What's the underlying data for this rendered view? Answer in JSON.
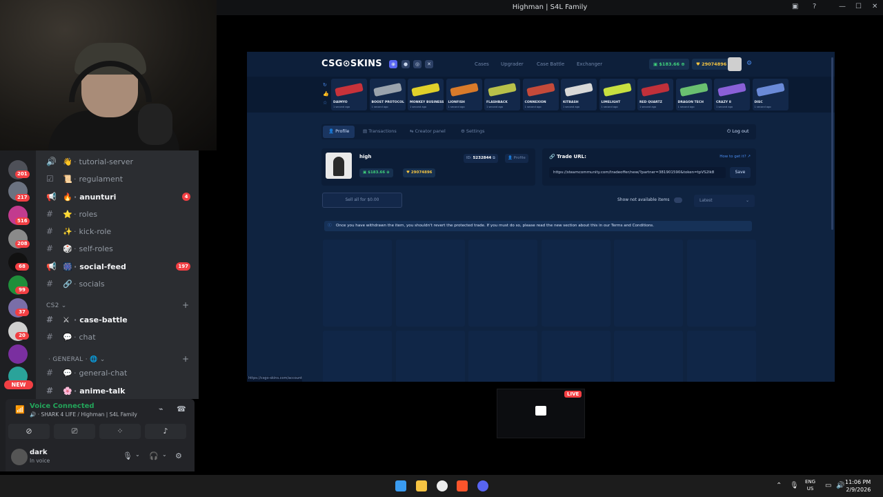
{
  "window": {
    "title": "Highman | S4L Family"
  },
  "discord": {
    "server_badges": [
      "201",
      "217",
      "516",
      "208",
      "68",
      "99",
      "37",
      "20"
    ],
    "new_badge": "NEW",
    "channels": [
      {
        "name": "tutorial-server",
        "emoji": "👋",
        "type": "voice",
        "bold": false
      },
      {
        "name": "regulament",
        "emoji": "📜",
        "type": "rules",
        "bold": false
      },
      {
        "name": "anunturi",
        "emoji": "🔥",
        "type": "announce",
        "bold": true,
        "mention": "4"
      },
      {
        "name": "roles",
        "emoji": "⭐",
        "type": "text",
        "bold": false
      },
      {
        "name": "kick-role",
        "emoji": "✨",
        "type": "text",
        "bold": false
      },
      {
        "name": "self-roles",
        "emoji": "🎲",
        "type": "text",
        "bold": false
      },
      {
        "name": "social-feed",
        "emoji": "🎆",
        "type": "announce",
        "bold": true,
        "mention": "197"
      },
      {
        "name": "socials",
        "emoji": "🔗",
        "type": "text",
        "bold": false
      }
    ],
    "category_cs2": "CS2",
    "cs2_channels": [
      {
        "name": "case-battle",
        "emoji": "⚔",
        "bold": true
      },
      {
        "name": "chat",
        "emoji": "💬",
        "bold": false
      }
    ],
    "category_general": "GENERAL",
    "general_channels": [
      {
        "name": "general-chat",
        "emoji": "💬",
        "bold": false
      },
      {
        "name": "anime-talk",
        "emoji": "🌸",
        "bold": true
      }
    ],
    "voice": {
      "status": "Voice Connected",
      "channel": "SHARK 4 LIFE / Highman | S4L Family"
    },
    "user": {
      "name": "dark",
      "status": "In voice"
    }
  },
  "site": {
    "logo": "CSG⊙SKINS",
    "nav": [
      "Cases",
      "Upgrader",
      "Case Battle",
      "Exchanger"
    ],
    "balance": "$183.66",
    "coins": "29074896",
    "drops": [
      {
        "name": "DAIMYO",
        "color": "#c8323a"
      },
      {
        "name": "BOOST PROTOCOL",
        "color": "#9aa3ad"
      },
      {
        "name": "MONKEY BUSINESS",
        "color": "#e0d02a"
      },
      {
        "name": "LIONFISH",
        "color": "#d97a2a"
      },
      {
        "name": "FLASHBACK",
        "color": "#b8c04a"
      },
      {
        "name": "CONNEXION",
        "color": "#c44a3a"
      },
      {
        "name": "KITBASH",
        "color": "#d8d8d8"
      },
      {
        "name": "LIMELIGHT",
        "color": "#c8e040"
      },
      {
        "name": "RED QUARTZ",
        "color": "#c0303a"
      },
      {
        "name": "DRAGON TECH",
        "color": "#6ac070"
      },
      {
        "name": "CRAZY 8",
        "color": "#8a60d8"
      },
      {
        "name": "DISC",
        "color": "#6a8ad8"
      }
    ],
    "drop_sub": "1 second ago",
    "tabs": [
      "Profile",
      "Transactions",
      "Creator panel",
      "Settings"
    ],
    "logout": "Log out",
    "profile": {
      "name": "high",
      "id_label": "ID:",
      "id": "5232844",
      "profile_link": "Profile",
      "balance": "$183.66",
      "coins": "29074896"
    },
    "trade": {
      "title": "Trade URL:",
      "help": "How to get it?",
      "url": "https://steamcommunity.com/tradeoffer/new/?partner=381901590&token=tpVS2lk8",
      "save": "Save"
    },
    "sell_all": "Sell all for $0.00",
    "show_na": "Show not available items",
    "sort": "Latest",
    "notice": "Once you have withdrawn the item, you shouldn't revert the protected trade. If you must do so, please read the new section about this in our Terms and Conditions.",
    "status_url": "https://csgo-skins.com/account"
  },
  "stream_thumb": {
    "live": "LIVE"
  },
  "taskbar": {
    "lang": "ENG",
    "region": "US",
    "time": "11:06 PM",
    "date": "2/9/2026"
  }
}
